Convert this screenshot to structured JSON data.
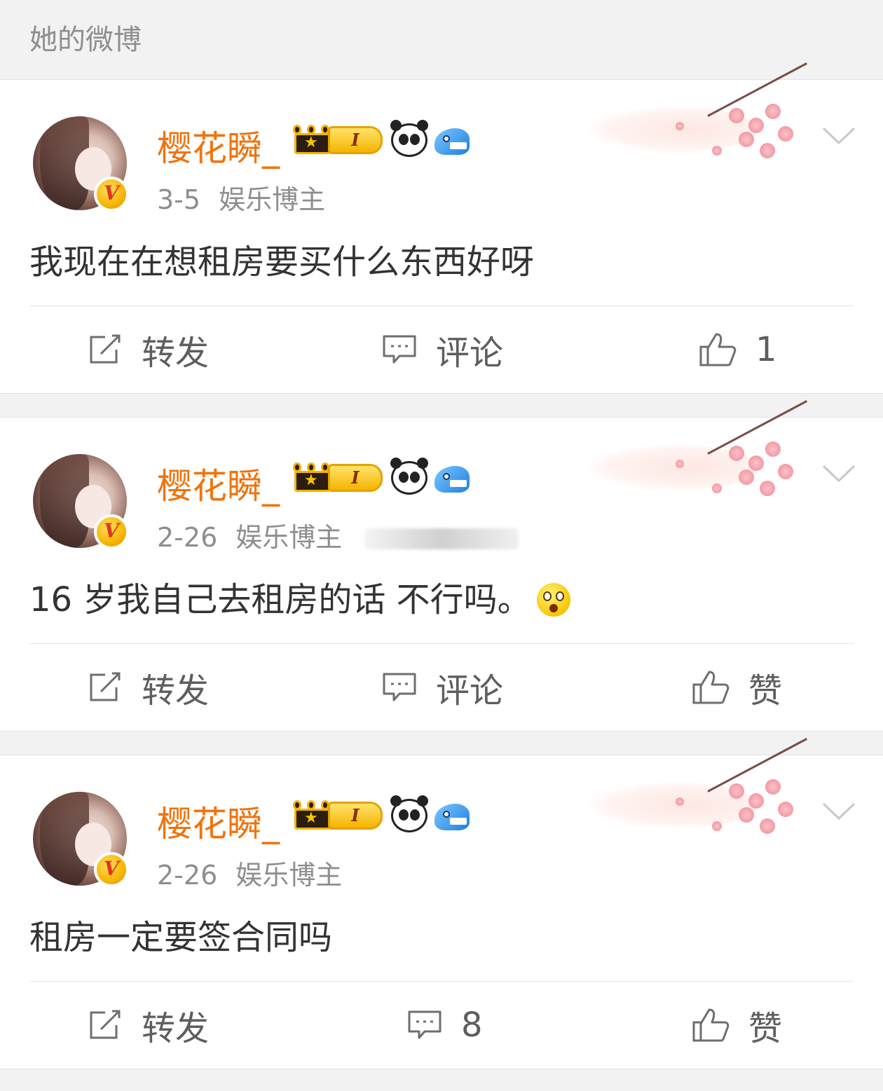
{
  "header": {
    "title": "她的微博"
  },
  "colors": {
    "username": "#f0730c",
    "meta": "#8e8e8e",
    "text": "#333333",
    "action": "#5e5e5e",
    "background": "#f2f2f2"
  },
  "posts": [
    {
      "username": "樱花瞬_",
      "level": "I",
      "date": "3-5",
      "source": "娱乐博主",
      "verified_badge": "V",
      "content": "我现在在想租房要买什么东西好呀",
      "repost_label": "转发",
      "comment_label": "评论",
      "like_label": "1",
      "icons": [
        "crown-badge-icon",
        "level-badge-icon",
        "panda-icon",
        "shark-icon",
        "cherry-blossom-decoration",
        "chevron-down-icon",
        "repost-icon",
        "comment-icon",
        "like-icon"
      ]
    },
    {
      "username": "樱花瞬_",
      "level": "I",
      "date": "2-26",
      "source": "娱乐博主",
      "verified_badge": "V",
      "content": "16 岁我自己去租房的话 不行吗。",
      "content_emoji": "surprised-emoji-icon",
      "repost_label": "转发",
      "comment_label": "评论",
      "like_label": "赞"
    },
    {
      "username": "樱花瞬_",
      "level": "I",
      "date": "2-26",
      "source": "娱乐博主",
      "verified_badge": "V",
      "content": "租房一定要签合同吗",
      "repost_label": "转发",
      "comment_label": "8",
      "like_label": "赞"
    }
  ]
}
